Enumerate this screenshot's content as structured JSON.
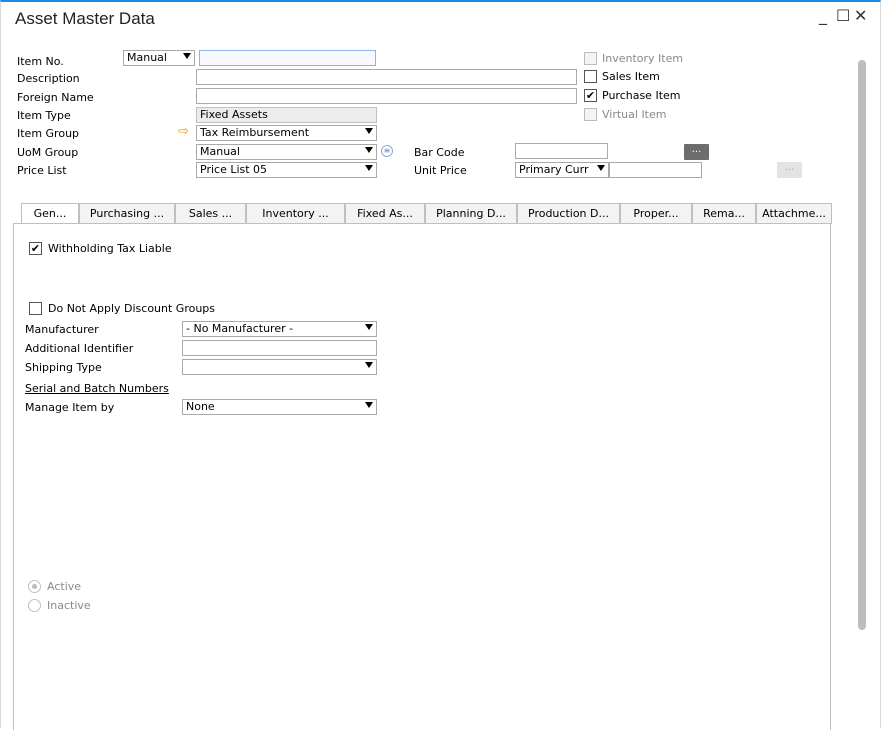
{
  "window": {
    "title": "Asset Master Data",
    "minimize": "_",
    "maximize": "☐",
    "close": "✕"
  },
  "header": {
    "item_no": {
      "label": "Item No.",
      "series": "Manual",
      "value": ""
    },
    "description": {
      "label": "Description",
      "value": ""
    },
    "foreign_name": {
      "label": "Foreign Name",
      "value": ""
    },
    "item_type": {
      "label": "Item Type",
      "value": "Fixed Assets"
    },
    "item_group": {
      "label": "Item Group",
      "value": "Tax Reimbursement"
    },
    "uom_group": {
      "label": "UoM Group",
      "value": "Manual"
    },
    "price_list": {
      "label": "Price List",
      "value": "Price List 05"
    },
    "bar_code": {
      "label": "Bar Code",
      "value": ""
    },
    "unit_price": {
      "label": "Unit Price",
      "currency": "Primary Curr",
      "value": ""
    },
    "more_btn": "..."
  },
  "checkboxes": {
    "inventory_item": {
      "label": "Inventory Item",
      "checked": ""
    },
    "sales_item": {
      "label": "Sales Item",
      "checked": ""
    },
    "purchase_item": {
      "label": "Purchase Item",
      "checked": "✔"
    },
    "virtual_item": {
      "label": "Virtual Item",
      "checked": ""
    }
  },
  "tabs": [
    "Gen...",
    "Purchasing ...",
    "Sales ...",
    "Inventory ...",
    "Fixed As...",
    "Planning D...",
    "Production D...",
    "Proper...",
    "Rema...",
    "Attachme..."
  ],
  "general": {
    "withholding": {
      "label": "Withholding Tax Liable",
      "checked": "✔"
    },
    "no_discount": {
      "label": "Do Not Apply Discount Groups",
      "checked": ""
    },
    "manufacturer": {
      "label": "Manufacturer",
      "value": "- No Manufacturer -"
    },
    "additional_identifier": {
      "label": "Additional Identifier",
      "value": ""
    },
    "shipping_type": {
      "label": "Shipping Type",
      "value": ""
    },
    "serial_batch": "Serial and Batch Numbers",
    "manage_by": {
      "label": "Manage Item by",
      "value": "None"
    },
    "active": "Active",
    "inactive": "Inactive"
  },
  "icons": {
    "arrow": "⇨",
    "info": "≡"
  }
}
